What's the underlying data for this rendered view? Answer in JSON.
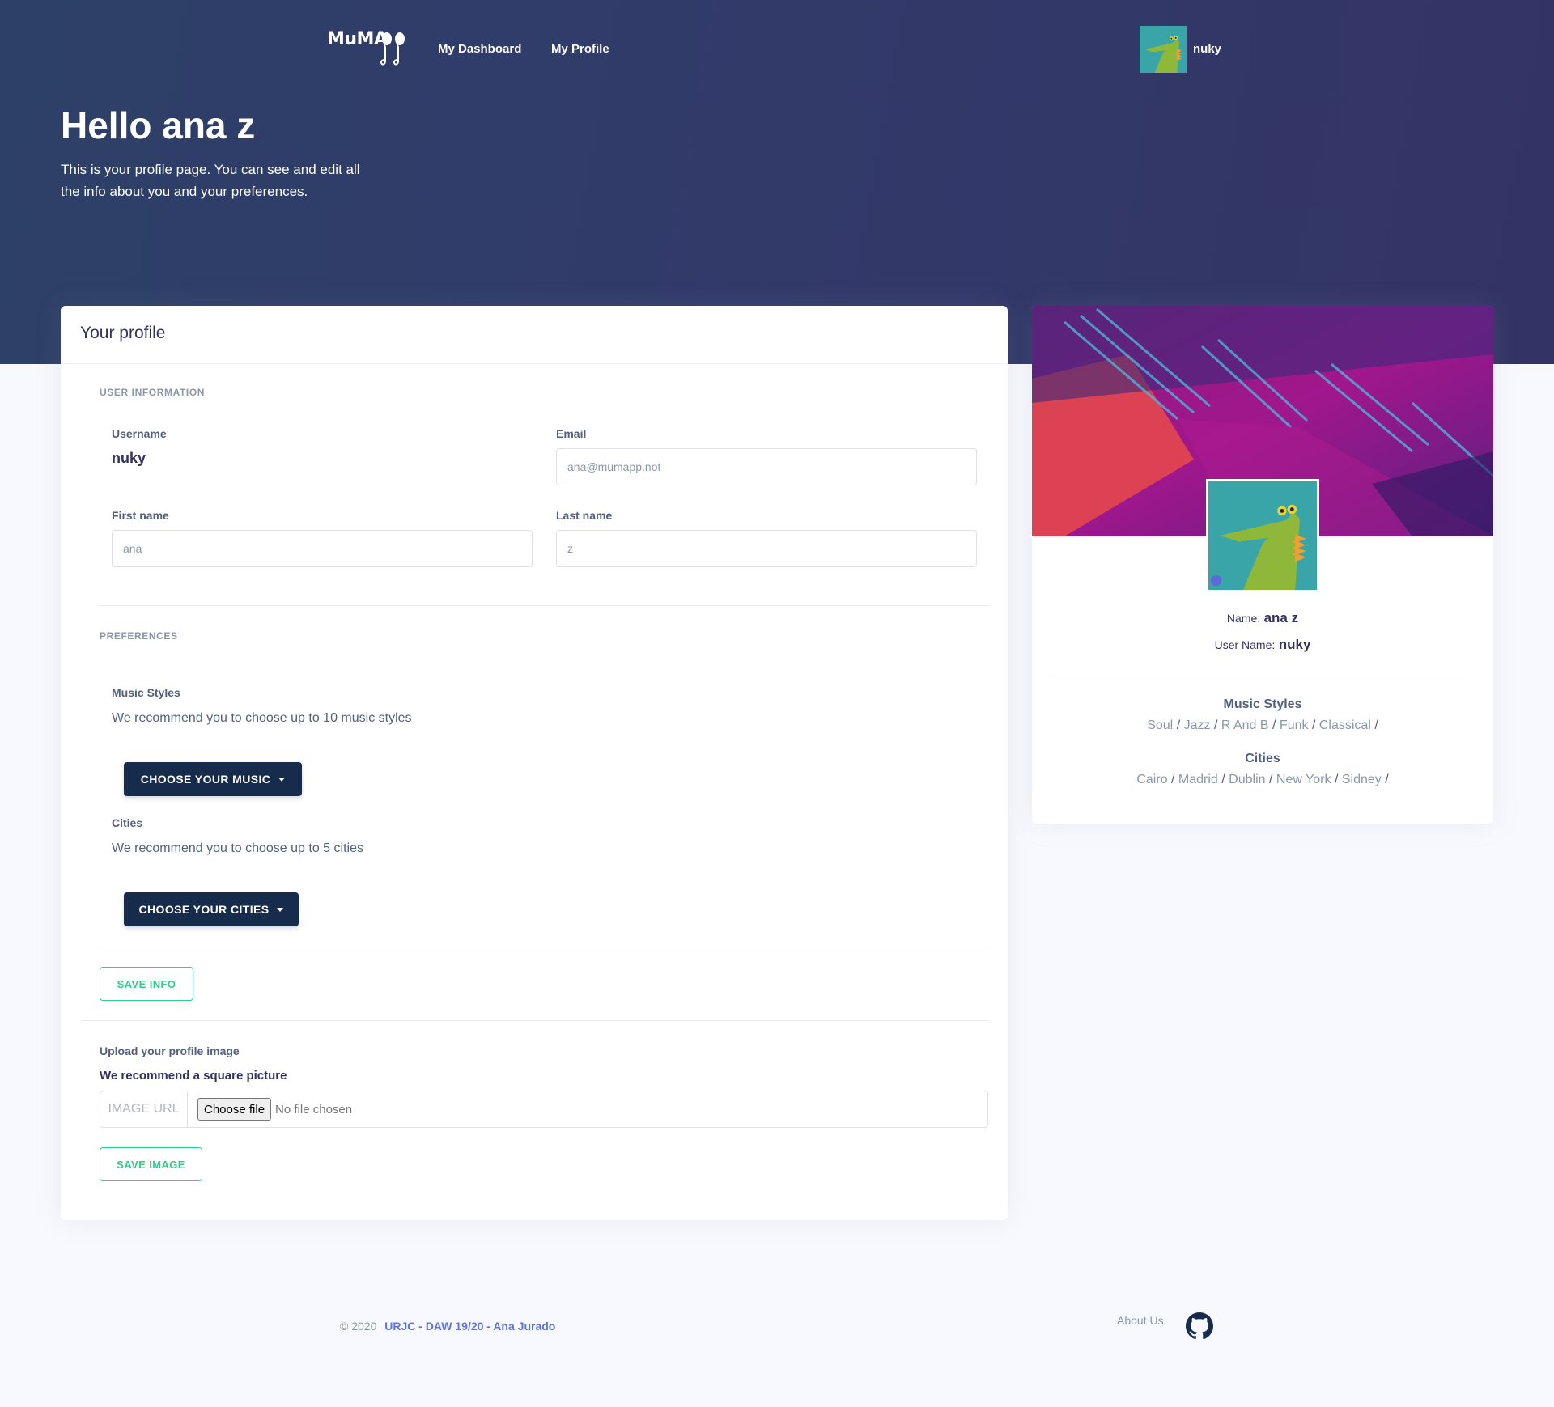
{
  "nav": {
    "logo_text": "MuMA",
    "links": [
      "My Dashboard",
      "My Profile"
    ],
    "username": "nuky"
  },
  "hero": {
    "title": "Hello ana z",
    "description": "This is your profile page. You can see and edit all the info about you and your preferences."
  },
  "profile_card": {
    "title": "Your profile",
    "user_info_heading": "User information",
    "username_label": "Username",
    "username_value": "nuky",
    "email_label": "Email",
    "email_placeholder": "ana@mumapp.not",
    "first_name_label": "First name",
    "first_name_placeholder": "ana",
    "last_name_label": "Last name",
    "last_name_placeholder": "z",
    "preferences_heading": "Preferences",
    "music_label": "Music Styles",
    "music_help": "We recommend you to choose up to 10 music styles",
    "music_button": "CHOOSE YOUR MUSIC",
    "cities_label": "Cities",
    "cities_help": "We recommend you to choose up to 5 cities",
    "cities_button": "CHOOSE YOUR CITIES",
    "save_info_button": "SAVE INFO",
    "upload_label": "Upload your profile image",
    "upload_hint": "We recommend a square picture",
    "image_url_prefix": "IMAGE URL",
    "choose_file_button": "Choose file",
    "file_status": "No file chosen",
    "save_image_button": "SAVE IMAGE"
  },
  "side_card": {
    "name_label": "Name:",
    "name_value": "ana z",
    "username_label": "User Name:",
    "username_value": "nuky",
    "music_heading": "Music Styles",
    "music_styles": [
      "Soul",
      "Jazz",
      "R And B",
      "Funk",
      "Classical"
    ],
    "cities_heading": "Cities",
    "cities": [
      "Cairo",
      "Madrid",
      "Dublin",
      "New York",
      "Sidney"
    ]
  },
  "footer": {
    "copyright": "© 2020",
    "credit_link": "URJC - DAW 19/20 - Ana Jurado",
    "about_link": "About Us"
  },
  "colors": {
    "hero": "#313a68",
    "primary_dark": "#172b4d",
    "success": "#2dce89",
    "link": "#5e72e4"
  },
  "icons": [
    "logo-notes-icon",
    "github-icon",
    "caret-down-icon"
  ]
}
